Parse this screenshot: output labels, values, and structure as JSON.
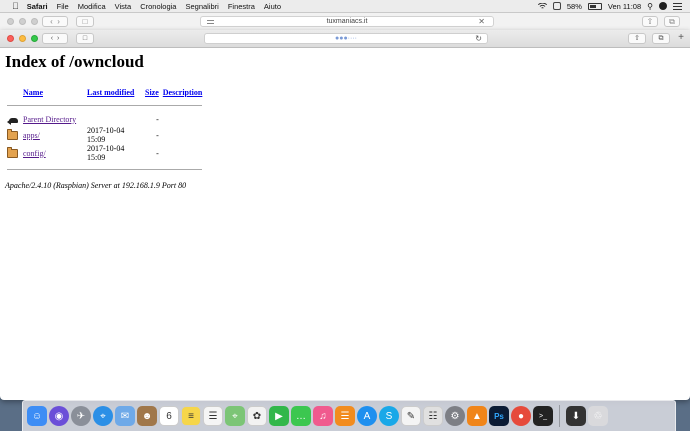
{
  "menubar": {
    "app_name": "Safari",
    "items": [
      "File",
      "Modifica",
      "Vista",
      "Cronologia",
      "Segnalibri",
      "Finestra",
      "Aiuto"
    ],
    "battery": "58%",
    "clock": "Ven 11:08"
  },
  "background_window": {
    "url": "tuxmaniacs.it"
  },
  "browser": {
    "url": "●●●····"
  },
  "page": {
    "title": "Index of /owncloud",
    "columns": {
      "name": "Name",
      "last_modified": "Last modified",
      "size": "Size",
      "description": "Description"
    },
    "rows": [
      {
        "name": "Parent Directory",
        "modified": "",
        "size": "-",
        "icon": "back-icon"
      },
      {
        "name": "apps/",
        "modified": "2017-10-04 15:09",
        "size": "-",
        "icon": "folder-icon"
      },
      {
        "name": "config/",
        "modified": "2017-10-04 15:09",
        "size": "-",
        "icon": "folder-icon"
      }
    ],
    "footer": "Apache/2.4.10 (Raspbian) Server at 192.168.1.9 Port 80"
  },
  "dock": {
    "apps": [
      {
        "name": "finder-icon",
        "color": "#3d8df5",
        "glyph": "☺"
      },
      {
        "name": "siri-icon",
        "color": "#6b4fd8",
        "glyph": "◉"
      },
      {
        "name": "launchpad-icon",
        "color": "#8a8f99",
        "glyph": "✈"
      },
      {
        "name": "safari-icon",
        "color": "#2b8fe6",
        "glyph": "⌖"
      },
      {
        "name": "mail-icon",
        "color": "#6ea9e8",
        "glyph": "✉"
      },
      {
        "name": "contacts-icon",
        "color": "#a0774a",
        "glyph": "☻"
      },
      {
        "name": "calendar-icon",
        "color": "#ffffff",
        "glyph": "6"
      },
      {
        "name": "notes-icon",
        "color": "#f6d64a",
        "glyph": "≡"
      },
      {
        "name": "reminders-icon",
        "color": "#f5f5f5",
        "glyph": "☰"
      },
      {
        "name": "maps-icon",
        "color": "#7cc576",
        "glyph": "⌖"
      },
      {
        "name": "photos-icon",
        "color": "#f2f2f2",
        "glyph": "✿"
      },
      {
        "name": "facetime-icon",
        "color": "#32b74a",
        "glyph": "▶"
      },
      {
        "name": "messages-icon",
        "color": "#3cc750",
        "glyph": "…"
      },
      {
        "name": "music-icon",
        "color": "#f05a8e",
        "glyph": "♫"
      },
      {
        "name": "books-icon",
        "color": "#f28c1e",
        "glyph": "☰"
      },
      {
        "name": "app-store-icon",
        "color": "#1e8fef",
        "glyph": "A"
      },
      {
        "name": "skype-icon",
        "color": "#19a8e8",
        "glyph": "S"
      },
      {
        "name": "textedit-icon",
        "color": "#f4f4f4",
        "glyph": "✎"
      },
      {
        "name": "microphone-icon",
        "color": "#e0e0e0",
        "glyph": "☷"
      },
      {
        "name": "system-preferences-icon",
        "color": "#7d7f85",
        "glyph": "⚙"
      },
      {
        "name": "vlc-icon",
        "color": "#f08519",
        "glyph": "▲"
      },
      {
        "name": "photoshop-icon",
        "color": "#0b1b34",
        "glyph": "Ps"
      },
      {
        "name": "chrome-icon",
        "color": "#e64a3b",
        "glyph": "●"
      },
      {
        "name": "terminal-icon",
        "color": "#222222",
        "glyph": ">_"
      }
    ],
    "right_items": [
      {
        "name": "downloads-stack-icon",
        "color": "#333333",
        "glyph": "⬇"
      },
      {
        "name": "trash-icon",
        "color": "#d9d9dc",
        "glyph": "♲"
      }
    ]
  }
}
